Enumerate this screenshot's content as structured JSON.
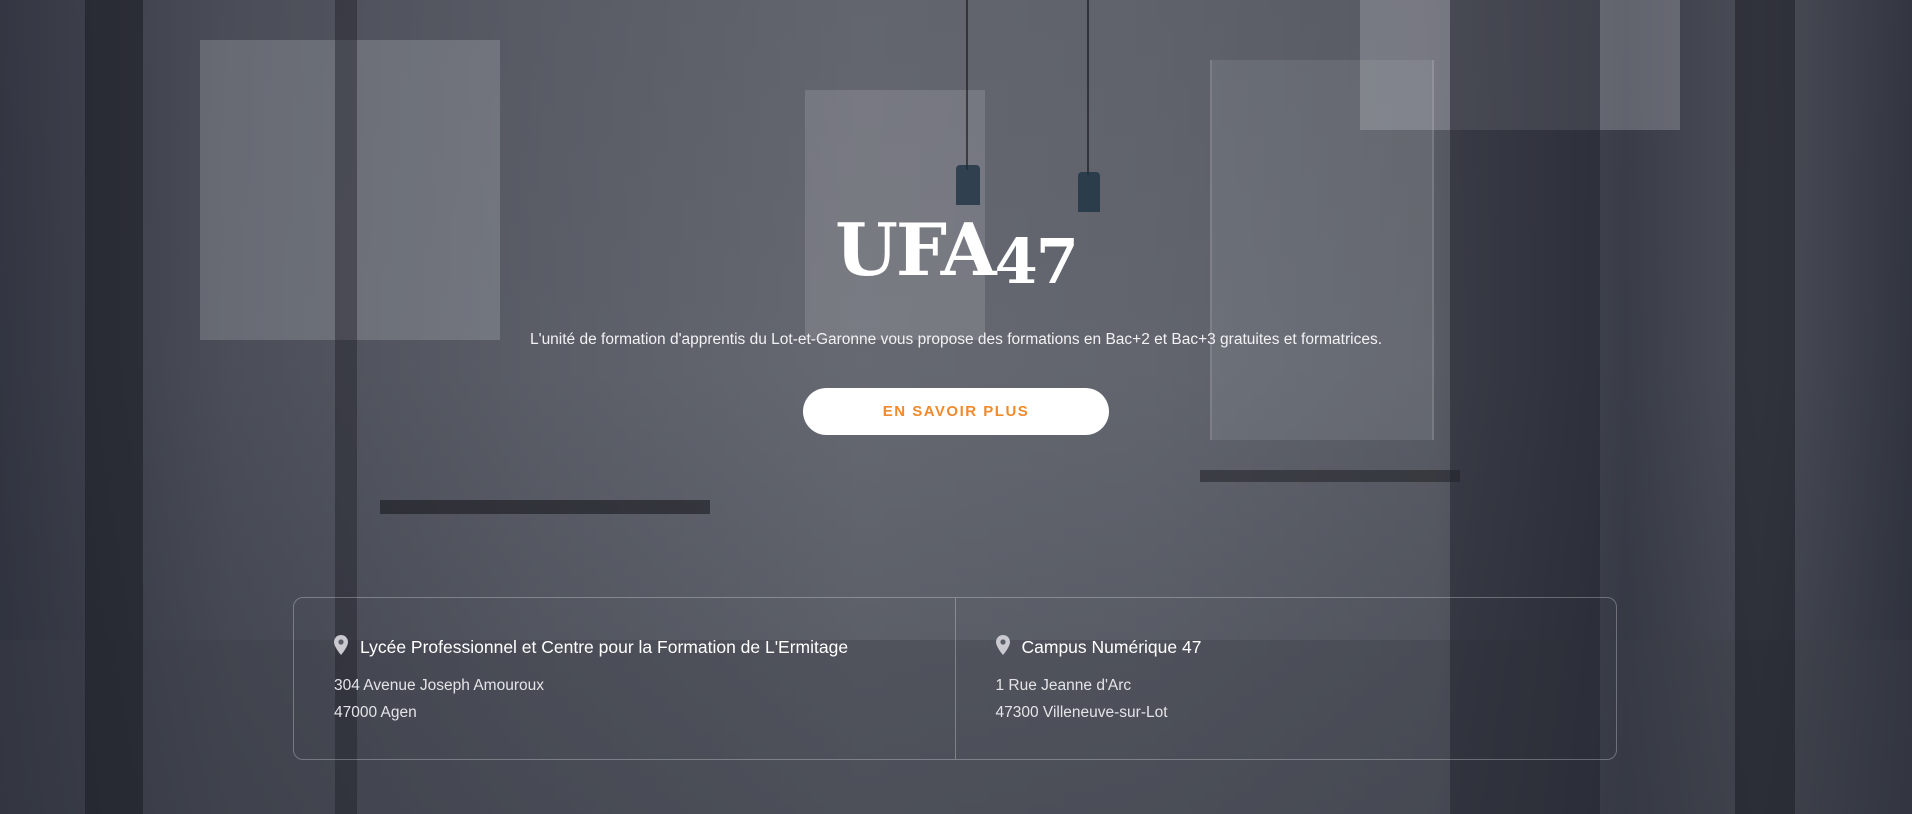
{
  "hero": {
    "logo_letters": "UFA",
    "logo_number": "47",
    "tagline": "L'unité de formation d'apprentis du Lot-et-Garonne vous propose des formations en Bac+2 et Bac+3 gratuites et formatrices.",
    "cta_label": "EN SAVOIR PLUS"
  },
  "locations": [
    {
      "title": "Lycée Professionnel et Centre pour la Formation de L'Ermitage",
      "address_line1": "304 Avenue Joseph Amouroux",
      "address_line2": "47000 Agen",
      "icon": "map-pin-icon"
    },
    {
      "title": "Campus Numérique 47",
      "address_line1": "1 Rue Jeanne d'Arc",
      "address_line2": "47300 Villeneuve-sur-Lot",
      "icon": "map-pin-icon"
    }
  ],
  "colors": {
    "accent": "#f08a2c",
    "button_bg": "#ffffff",
    "text": "#ffffff"
  }
}
